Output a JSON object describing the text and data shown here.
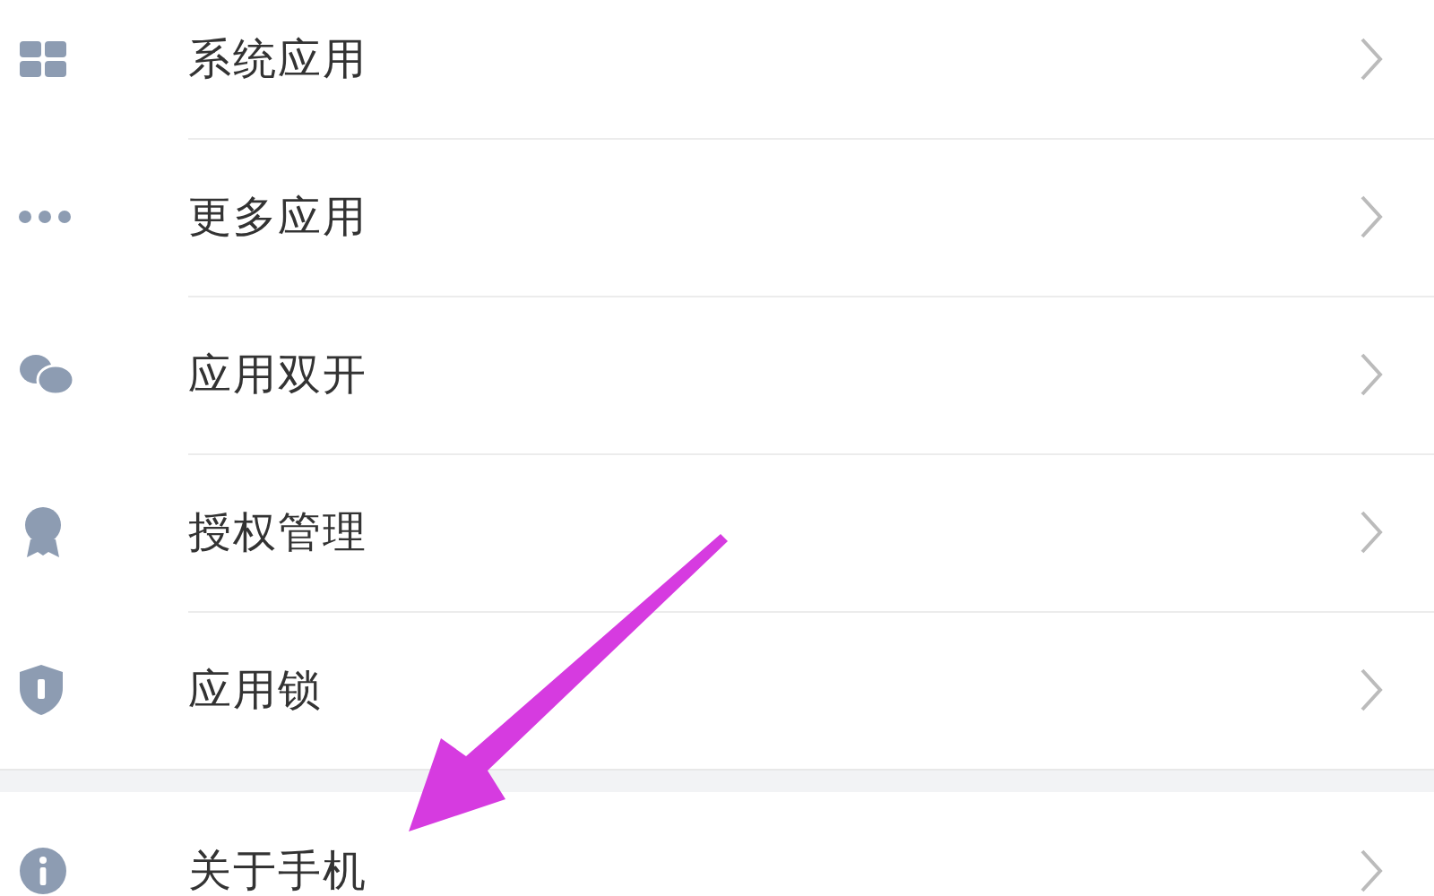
{
  "groups": [
    {
      "items": [
        {
          "label": "系统应用",
          "kind": "grid"
        },
        {
          "label": "更多应用",
          "kind": "dots"
        },
        {
          "label": "应用双开",
          "kind": "bubbles"
        },
        {
          "label": "授权管理",
          "kind": "badge"
        },
        {
          "label": "应用锁",
          "kind": "shield"
        }
      ]
    },
    {
      "items": [
        {
          "label": "关于手机",
          "kind": "info"
        }
      ]
    }
  ]
}
